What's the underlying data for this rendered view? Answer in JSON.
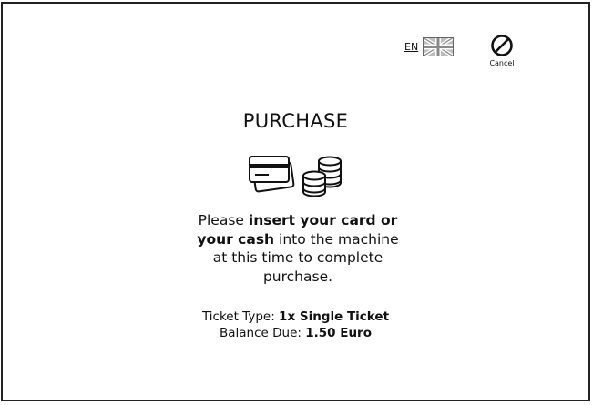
{
  "language": {
    "code": "EN",
    "flag_icon": "uk-flag-icon"
  },
  "cancel": {
    "label": "Cancel",
    "icon": "no-entry-icon"
  },
  "title": "PURCHASE",
  "payment_icons": [
    "credit-card-icon",
    "coin-stack-icon"
  ],
  "instruction": {
    "part1": "Please ",
    "bold1": "insert your card or your cash",
    "part2": " into the machine at this time to complete purchase."
  },
  "ticket": {
    "type_label": "Ticket Type: ",
    "type_value": "1x Single Ticket"
  },
  "balance": {
    "label": "Balance Due: ",
    "value": "1.50 Euro"
  },
  "colors": {
    "stroke": "#222222",
    "flag_fill": "#bdbdbd"
  }
}
